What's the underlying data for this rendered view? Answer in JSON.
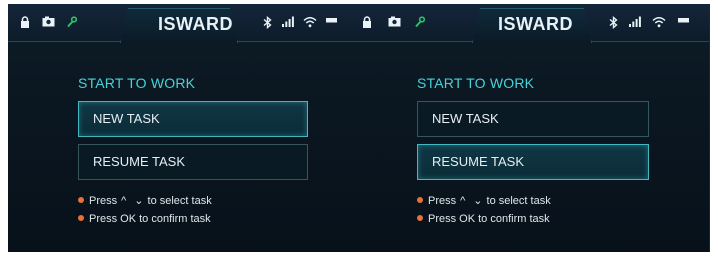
{
  "screens": [
    {
      "title": "ISWARD",
      "heading": "START TO WORK",
      "new_task_label": "NEW TASK",
      "resume_task_label": "RESUME TASK",
      "selected": "new_task",
      "hint_select_prefix": "Press",
      "hint_select_suffix": "to select task",
      "hint_confirm": "Press OK to confirm task"
    },
    {
      "title": "ISWARD",
      "heading": "START TO WORK",
      "new_task_label": "NEW TASK",
      "resume_task_label": "RESUME TASK",
      "selected": "resume_task",
      "hint_select_prefix": "Press",
      "hint_select_suffix": "to select task",
      "hint_confirm": "Press OK to confirm task"
    }
  ],
  "status_icons": [
    "lock-icon",
    "camera-icon",
    "wrench-icon",
    "bluetooth-icon",
    "signal-icon",
    "wifi-icon",
    "battery-icon"
  ],
  "colors": {
    "accent": "#48d3d8",
    "selected_border": "#3fb8c4",
    "bullet": "#e8703a",
    "wrench": "#2fbf6a"
  }
}
